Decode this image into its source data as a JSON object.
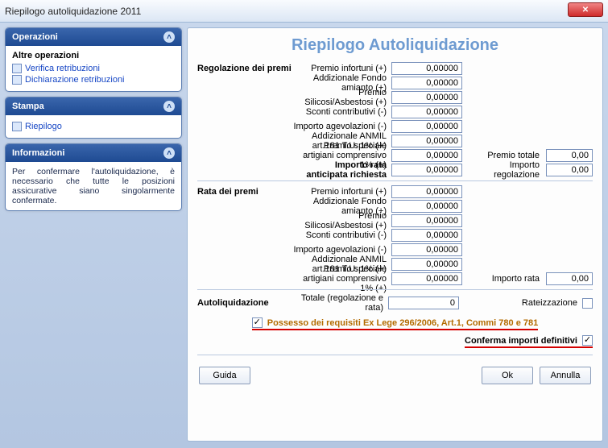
{
  "window": {
    "title": "Riepilogo autoliquidazione 2011"
  },
  "sidebar": {
    "operazioni": {
      "title": "Operazioni",
      "subhead": "Altre operazioni",
      "links": [
        {
          "label": "Verifica retribuzioni"
        },
        {
          "label": "Dichiarazione retribuzioni"
        }
      ]
    },
    "stampa": {
      "title": "Stampa",
      "links": [
        {
          "label": "Riepilogo"
        }
      ]
    },
    "informazioni": {
      "title": "Informazioni",
      "text": "Per confermare l'autoliquidazione, è necessario che tutte le posizioni assicurative siano singolarmente confermate."
    }
  },
  "main": {
    "heading": "Riepilogo Autoliquidazione",
    "regolazione": {
      "section": "Regolazione dei premi",
      "rows": [
        {
          "label": "Premio infortuni (+)",
          "value": "0,00000"
        },
        {
          "label": "Addizionale Fondo amianto (+)",
          "value": "0,00000"
        },
        {
          "label": "Premio Silicosi/Asbestosi (+)",
          "value": "0,00000"
        },
        {
          "label": "Sconti contributivi (-)",
          "value": "0,00000"
        },
        {
          "label": "Importo agevolazioni (-)",
          "value": "0,00000"
        },
        {
          "label": "Addizionale ANMIL art.181 T.U. 1% (+)",
          "value": "0,00000"
        },
        {
          "label": "Premio speciale artigiani comprensivo 1% (+)",
          "value": "0,00000"
        }
      ],
      "premio_totale_label": "Premio totale",
      "premio_totale_value": "0,00",
      "importo_rata_label": "Importo rata anticipata richiesta",
      "importo_rata_value": "0,00000",
      "importo_regolazione_label": "Importo regolazione",
      "importo_regolazione_value": "0,00"
    },
    "rata": {
      "section": "Rata dei premi",
      "rows": [
        {
          "label": "Premio infortuni (+)",
          "value": "0,00000"
        },
        {
          "label": "Addizionale Fondo amianto (+)",
          "value": "0,00000"
        },
        {
          "label": "Premio Silicosi/Asbestosi (+)",
          "value": "0,00000"
        },
        {
          "label": "Sconti contributivi (-)",
          "value": "0,00000"
        },
        {
          "label": "Importo agevolazioni (-)",
          "value": "0,00000"
        },
        {
          "label": "Addizionale ANMIL art.181 T.U. 1% (+)",
          "value": "0,00000"
        },
        {
          "label": "Premio speciale artigiani comprensivo 1% (+)",
          "value": "0,00000"
        }
      ],
      "importo_rata_label": "Importo rata",
      "importo_rata_value": "0,00"
    },
    "autoliquidazione": {
      "section": "Autoliquidazione",
      "totale_label": "Totale (regolazione e rata)",
      "totale_value": "0",
      "rateizzazione_label": "Rateizzazione",
      "possesso_label": "Possesso dei requisiti Ex Lege 296/2006, Art.1, Commi 780 e 781",
      "conferma_label": "Conferma importi definitivi"
    },
    "buttons": {
      "guida": "Guida",
      "ok": "Ok",
      "annulla": "Annulla"
    }
  }
}
